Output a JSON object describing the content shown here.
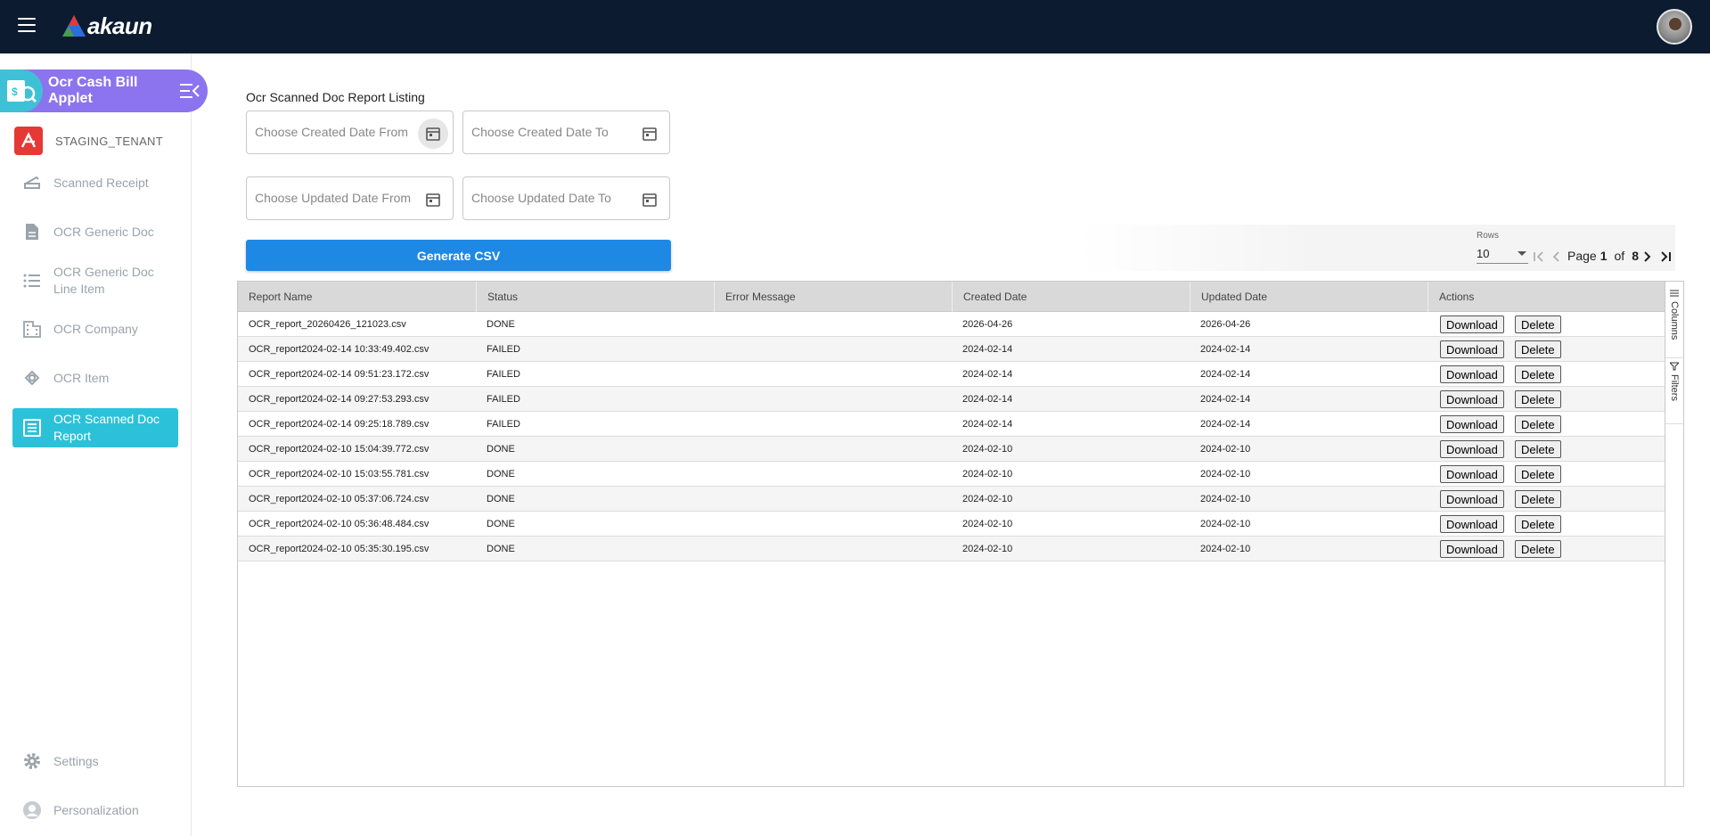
{
  "app": {
    "brand": "akaun",
    "applet_title": "Ocr Cash Bill Applet",
    "tenant": "STAGING_TENANT"
  },
  "sidebar": {
    "items": [
      {
        "label": "Scanned Receipt",
        "icon": "scanner-icon"
      },
      {
        "label": "OCR Generic Doc",
        "icon": "document-icon"
      },
      {
        "label": "OCR Generic Doc Line Item",
        "icon": "list-icon"
      },
      {
        "label": "OCR Company",
        "icon": "building-icon"
      },
      {
        "label": "OCR Item",
        "icon": "item-icon"
      },
      {
        "label": "OCR Scanned Doc Report",
        "icon": "report-icon",
        "active": true
      }
    ],
    "footer": [
      {
        "label": "Settings",
        "icon": "gear-icon"
      },
      {
        "label": "Personalization",
        "icon": "person-icon"
      }
    ]
  },
  "main": {
    "title": "Ocr Scanned Doc Report Listing",
    "filters": {
      "created_from": "Choose Created Date From",
      "created_to": "Choose Created Date To",
      "updated_from": "Choose Updated Date From",
      "updated_to": "Choose Updated Date To"
    },
    "generate_label": "Generate CSV"
  },
  "pagination": {
    "rows_label": "Rows",
    "rows_value": "10",
    "page_label": "Page",
    "current_page": "1",
    "of_label": "of",
    "total_pages": "8"
  },
  "grid": {
    "columns": [
      "Report Name",
      "Status",
      "Error Message",
      "Created Date",
      "Updated Date",
      "Actions"
    ],
    "download_label": "Download",
    "delete_label": "Delete",
    "side_tabs": [
      "Columns",
      "Filters"
    ],
    "rows": [
      {
        "name": "OCR_report_20260426_121023.csv",
        "status": "DONE",
        "error": "",
        "created": "2026-04-26",
        "updated": "2026-04-26"
      },
      {
        "name": "OCR_report2024-02-14 10:33:49.402.csv",
        "status": "FAILED",
        "error": "",
        "created": "2024-02-14",
        "updated": "2024-02-14"
      },
      {
        "name": "OCR_report2024-02-14 09:51:23.172.csv",
        "status": "FAILED",
        "error": "",
        "created": "2024-02-14",
        "updated": "2024-02-14"
      },
      {
        "name": "OCR_report2024-02-14 09:27:53.293.csv",
        "status": "FAILED",
        "error": "",
        "created": "2024-02-14",
        "updated": "2024-02-14"
      },
      {
        "name": "OCR_report2024-02-14 09:25:18.789.csv",
        "status": "FAILED",
        "error": "",
        "created": "2024-02-14",
        "updated": "2024-02-14"
      },
      {
        "name": "OCR_report2024-02-10 15:04:39.772.csv",
        "status": "DONE",
        "error": "",
        "created": "2024-02-10",
        "updated": "2024-02-10"
      },
      {
        "name": "OCR_report2024-02-10 15:03:55.781.csv",
        "status": "DONE",
        "error": "",
        "created": "2024-02-10",
        "updated": "2024-02-10"
      },
      {
        "name": "OCR_report2024-02-10 05:37:06.724.csv",
        "status": "DONE",
        "error": "",
        "created": "2024-02-10",
        "updated": "2024-02-10"
      },
      {
        "name": "OCR_report2024-02-10 05:36:48.484.csv",
        "status": "DONE",
        "error": "",
        "created": "2024-02-10",
        "updated": "2024-02-10"
      },
      {
        "name": "OCR_report2024-02-10 05:35:30.195.csv",
        "status": "DONE",
        "error": "",
        "created": "2024-02-10",
        "updated": "2024-02-10"
      }
    ]
  },
  "colors": {
    "topbar": "#0c1b2f",
    "applet_banner": "#8b74ee",
    "active_nav": "#2bc2d9",
    "primary_button": "#1e88e5"
  }
}
